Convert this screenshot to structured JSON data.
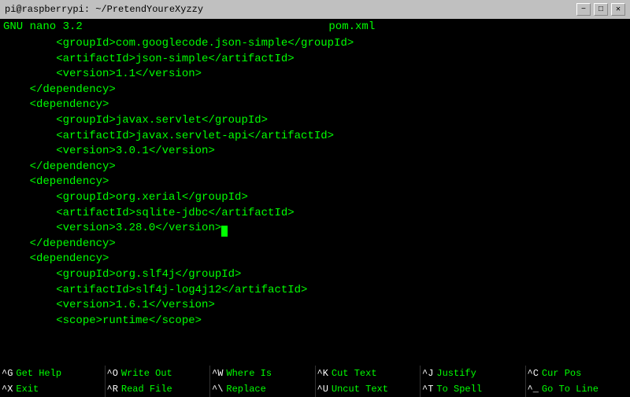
{
  "titlebar": {
    "left_text": "pi@raspberrypi: ~/PretendYoureXyzzy",
    "minimize": "−",
    "maximize": "□",
    "close": "✕"
  },
  "nano_header": {
    "version": "GNU nano  3.2",
    "filename": "pom.xml"
  },
  "editor": {
    "lines": [
      "        <groupId>com.googlecode.json-simple</groupId>",
      "        <artifactId>json-simple</artifactId>",
      "        <version>1.1</version>",
      "    </dependency>",
      "    <dependency>",
      "        <groupId>javax.servlet</groupId>",
      "        <artifactId>javax.servlet-api</artifactId>",
      "        <version>3.0.1</version>",
      "    </dependency>",
      "    <dependency>",
      "        <groupId>org.xerial</groupId>",
      "        <artifactId>sqlite-jdbc</artifactId>",
      "        <version>3.28.0</version>|CURSOR|",
      "    </dependency>",
      "    <dependency>",
      "        <groupId>org.slf4j</groupId>",
      "        <artifactId>slf4j-log4j12</artifactId>",
      "        <version>1.6.1</version>",
      "        <scope>runtime</scope>"
    ]
  },
  "shortcuts": {
    "row1": [
      {
        "key": "^G",
        "label": "Get Help"
      },
      {
        "key": "^O",
        "label": "Write Out"
      },
      {
        "key": "^W",
        "label": "Where Is"
      },
      {
        "key": "^K",
        "label": "Cut Text"
      },
      {
        "key": "^J",
        "label": "Justify"
      },
      {
        "key": "^C",
        "label": "Cur Pos"
      }
    ],
    "row2": [
      {
        "key": "^X",
        "label": "Exit"
      },
      {
        "key": "^R",
        "label": "Read File"
      },
      {
        "key": "^\\",
        "label": "Replace"
      },
      {
        "key": "^U",
        "label": "Uncut Text"
      },
      {
        "key": "^T",
        "label": "To Spell"
      },
      {
        "key": "^_",
        "label": "Go To Line"
      }
    ]
  }
}
